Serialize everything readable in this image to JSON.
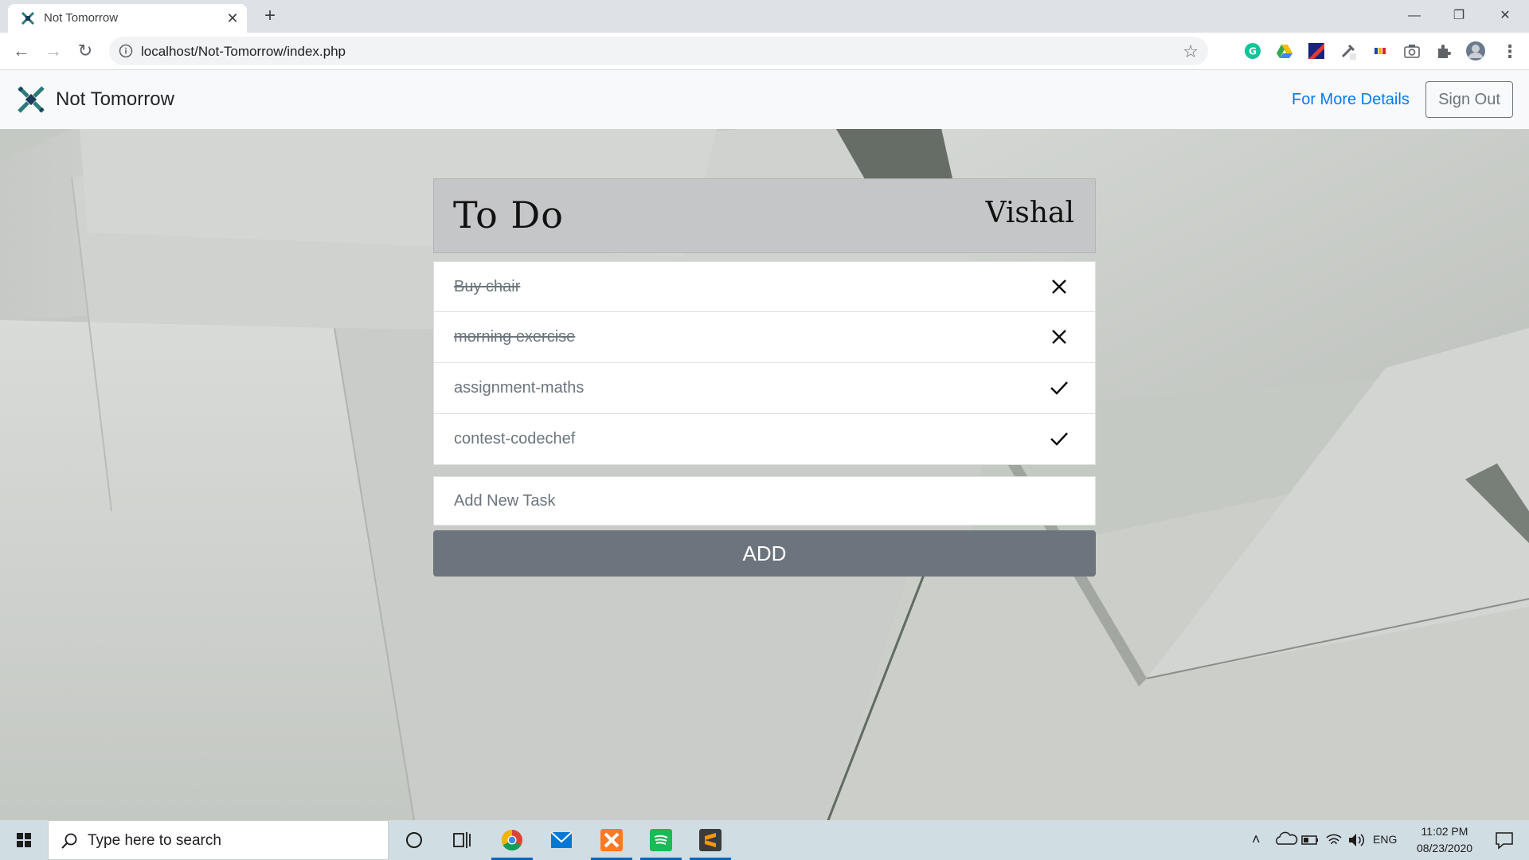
{
  "browser": {
    "tab_title": "Not Tomorrow",
    "tab_close": "✕",
    "new_tab": "+",
    "url": "localhost/Not-Tomorrow/index.php",
    "window_controls": {
      "minimize": "—",
      "maximize": "❐",
      "close": "✕"
    }
  },
  "navbar": {
    "brand": "Not Tomorrow",
    "link": "For More Details",
    "signout": "Sign Out"
  },
  "todo": {
    "title": "To Do",
    "user": "Vishal",
    "tasks": [
      {
        "text": "Buy chair",
        "done": true,
        "action_icon": "close-icon"
      },
      {
        "text": "morning exercise",
        "done": true,
        "action_icon": "close-icon"
      },
      {
        "text": "assignment-maths",
        "done": false,
        "action_icon": "check-icon"
      },
      {
        "text": "contest-codechef",
        "done": false,
        "action_icon": "check-icon"
      }
    ],
    "input_placeholder": "Add New Task",
    "add_label": "ADD"
  },
  "taskbar": {
    "search_placeholder": "Type here to search",
    "language": "ENG",
    "time": "11:02 PM",
    "date": "08/23/2020"
  },
  "colors": {
    "link": "#007bff",
    "secondary": "#6c757d",
    "header_bg": "#c5c6c7",
    "taskbar_bg": "#d0dde3"
  }
}
